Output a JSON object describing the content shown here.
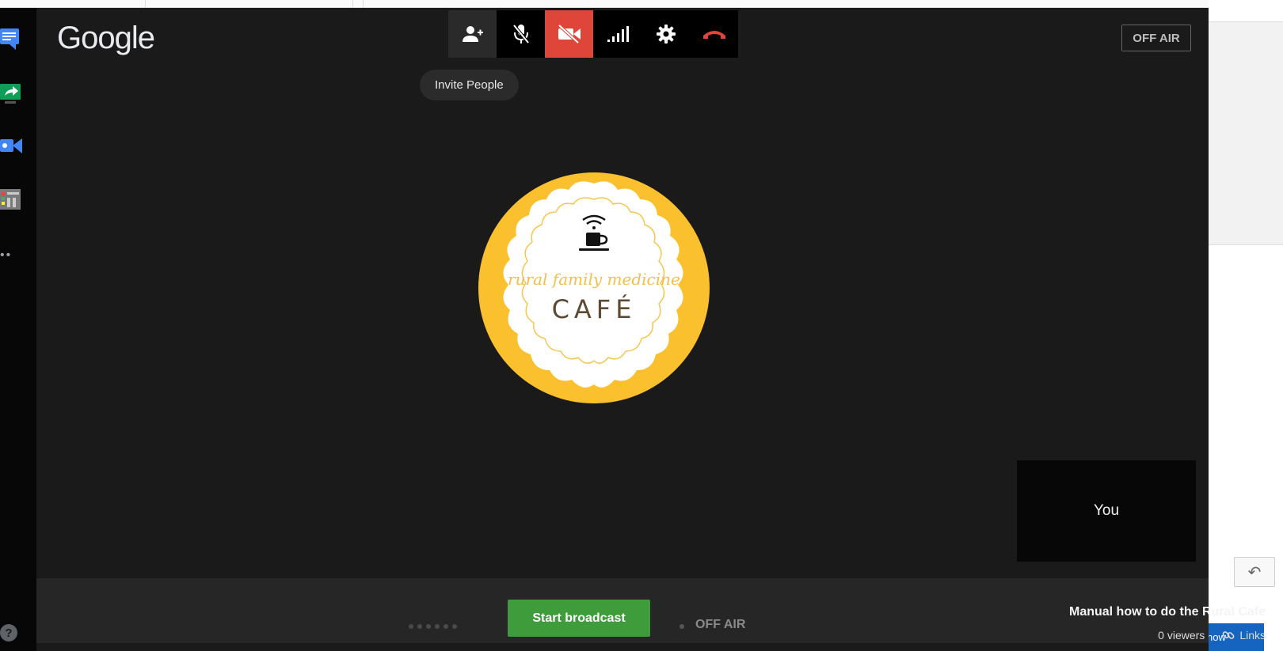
{
  "app": {
    "logo_text": "Google"
  },
  "side_rail": {
    "items": [
      {
        "name": "chat",
        "icon": "chat-icon",
        "color": "#4285f4"
      },
      {
        "name": "screenshare",
        "icon": "screenshare-icon",
        "color": "#0f9d58"
      },
      {
        "name": "video",
        "icon": "video-app-icon",
        "color": "#4285f4"
      },
      {
        "name": "control-room",
        "icon": "control-room-icon",
        "color": "#9e9e9e"
      }
    ],
    "more_label": "••",
    "help_label": "?"
  },
  "toolbar": {
    "buttons": [
      {
        "name": "invite-people",
        "icon": "person-add-icon"
      },
      {
        "name": "mute-mic",
        "icon": "mic-off-icon"
      },
      {
        "name": "turn-off-camera",
        "icon": "camera-off-icon",
        "active_color": "#e0453a"
      },
      {
        "name": "bandwidth",
        "icon": "signal-bars-icon"
      },
      {
        "name": "settings",
        "icon": "gear-icon"
      },
      {
        "name": "hang-up",
        "icon": "hang-up-icon",
        "color": "#e0453a"
      }
    ],
    "tooltip": "Invite People"
  },
  "on_air_badge": "OFF AIR",
  "stage": {
    "logo_script_text": "rural family medicine",
    "logo_main_text": "CAFÉ",
    "logo_colors": {
      "ring": "#fbc02d",
      "inner": "#ffffff",
      "text": "#5d4a32",
      "script": "#f2c04a"
    }
  },
  "self_view": {
    "label": "You"
  },
  "broadcast": {
    "start_label": "Start broadcast",
    "status": "OFF AIR",
    "title": "Manual how to do the Rural Cafe",
    "viewers": "0 viewers",
    "links_label": "Links",
    "button_color": "#3e9c3a"
  },
  "background_page": {
    "now_button": "now",
    "reply_icon": "reply-icon"
  }
}
